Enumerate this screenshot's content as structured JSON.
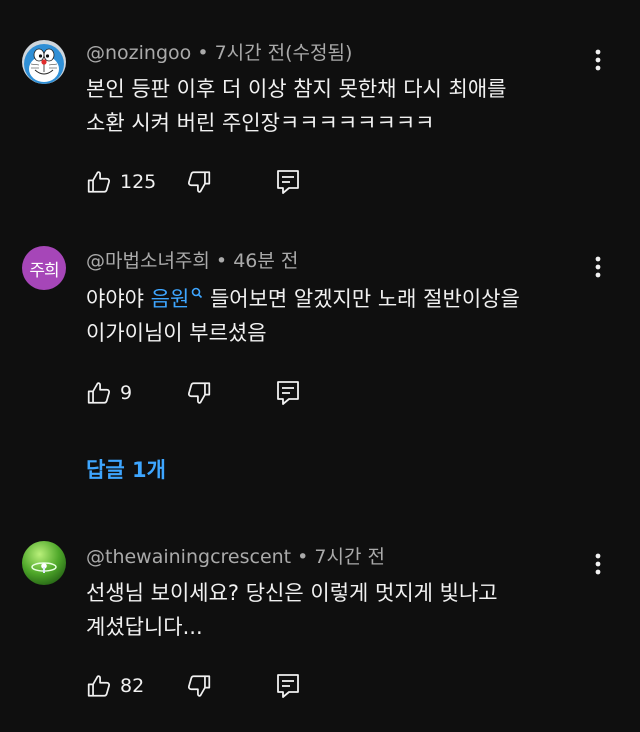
{
  "colors": {
    "background": "#0f0f0f",
    "text_primary": "#f1f1f1",
    "text_secondary": "#aaaaaa",
    "link_blue": "#3ea6ff",
    "avatar_purple": "#a646b8"
  },
  "comments": [
    {
      "handle": "@nozingoo",
      "meta": "7시간 전(수정됨)",
      "lines": [
        "본인 등판 이후 더 이상 참지 못한채 다시 최애를",
        "소환 시켜 버린 주인장ㅋㅋㅋㅋㅋㅋㅋㅋ"
      ],
      "likes": "125",
      "avatar_icon": "doraemon-avatar"
    },
    {
      "handle": "@마법소녀주희",
      "meta": "46분 전",
      "avatar_text": "주희",
      "line1_prefix": "야야야 ",
      "music_link": "음원",
      "line1_suffix": " 들어보면 알겠지만 노래 절반이상을",
      "line2": "이가이님이 부르셨음",
      "likes": "9",
      "replies_label": "답글 1개"
    },
    {
      "handle": "@thewainingcrescent",
      "meta": "7시간 전",
      "lines": [
        "선생님 보이세요? 당신은 이렇게 멋지게 빛나고",
        "계셨답니다..."
      ],
      "likes": "82",
      "avatar_icon": "green-sphere-avatar"
    }
  ],
  "separator": " • "
}
